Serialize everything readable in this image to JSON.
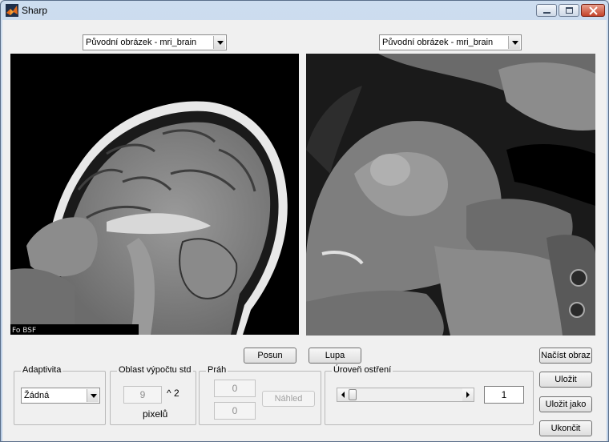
{
  "window": {
    "title": "Sharp"
  },
  "left_panel": {
    "dropdown_value": "Původní obrázek - mri_brain",
    "image_caption": "Fo BSF"
  },
  "right_panel": {
    "dropdown_value": "Původní obrázek - mri_brain"
  },
  "buttons": {
    "posun": "Posun",
    "lupa": "Lupa",
    "nacist": "Načíst obraz",
    "ulozit": "Uložit",
    "ulozit_jako": "Uložit jako",
    "ukoncit": "Ukončit"
  },
  "adaptivita": {
    "legend": "Adaptivita",
    "value": "Žádná"
  },
  "oblast": {
    "legend": "Oblast výpočtu std",
    "value": "9",
    "exponent_label": "^ 2",
    "unit": "pixelů"
  },
  "prah": {
    "legend": "Práh",
    "value1": "0",
    "value2": "0",
    "preview_button": "Náhled"
  },
  "uroven": {
    "legend": "Úroveň ostření",
    "value": "1",
    "slider_level": 0.0
  },
  "colors": {
    "title_bar": "#b9cde6",
    "close_button": "#c4432a",
    "client_bg": "#f0f0f0"
  }
}
